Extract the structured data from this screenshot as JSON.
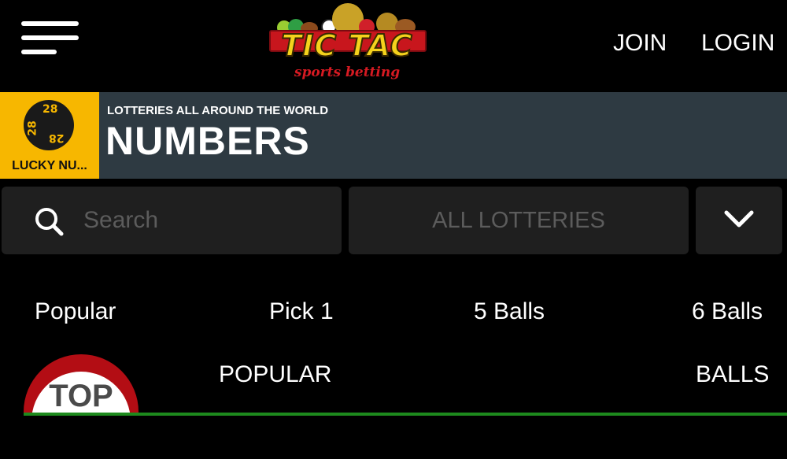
{
  "header": {
    "brand": {
      "name": "TIC TAC",
      "tagline": "sports betting"
    },
    "join_label": "JOIN",
    "login_label": "LOGIN"
  },
  "banner": {
    "badge_label": "LUCKY NU...",
    "badge_numbers": [
      "28",
      "28",
      "28"
    ],
    "subtitle": "LOTTERIES ALL AROUND THE WORLD",
    "title": "NUMBERS",
    "colors": {
      "badge_bg": "#f7b700",
      "banner_bg": "#2e3a42"
    }
  },
  "filters": {
    "search_placeholder": "Search",
    "lottery_select_value": "ALL LOTTERIES"
  },
  "category_tabs": [
    "Popular",
    "Pick 1",
    "5 Balls",
    "6 Balls"
  ],
  "section": {
    "badge_text": "TOP",
    "left_label": "POPULAR",
    "right_label": "BALLS",
    "colors": {
      "accent_line": "#1d8a1d",
      "badge_red": "#b30d14"
    }
  }
}
